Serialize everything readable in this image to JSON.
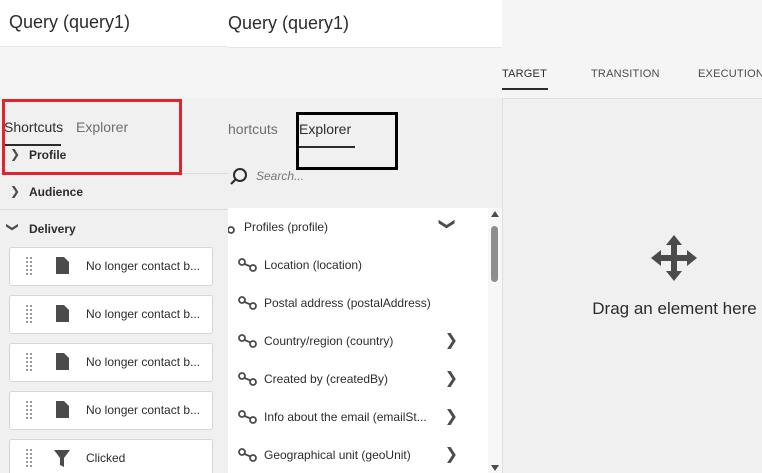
{
  "left_panel": {
    "title": "Query (query1)",
    "tabs": {
      "shortcuts": "Shortcuts",
      "explorer": "Explorer"
    },
    "sections": {
      "profile": "Profile",
      "audience": "Audience",
      "delivery": "Delivery"
    },
    "items": [
      {
        "label": "No longer contact b...",
        "icon": "document-icon"
      },
      {
        "label": "No longer contact b...",
        "icon": "document-icon"
      },
      {
        "label": "No longer contact b...",
        "icon": "document-icon"
      },
      {
        "label": "No longer contact b...",
        "icon": "document-icon"
      },
      {
        "label": "Clicked",
        "icon": "filter-icon"
      }
    ]
  },
  "middle_panel": {
    "title": "Query (query1)",
    "tabs": {
      "shortcuts": "hortcuts",
      "explorer": "Explorer"
    },
    "search": {
      "placeholder": "Search..."
    },
    "tree": [
      {
        "label": "Profiles (profile)",
        "indicator": "chevron-down"
      },
      {
        "label": "Location (location)",
        "indicator": "none"
      },
      {
        "label": "Postal address (postalAddress)",
        "indicator": "none"
      },
      {
        "label": "Country/region (country)",
        "indicator": "chevron-right"
      },
      {
        "label": "Created by (createdBy)",
        "indicator": "chevron-right"
      },
      {
        "label": "Info about the email (emailSt...",
        "indicator": "chevron-right"
      },
      {
        "label": "Geographical unit (geoUnit)",
        "indicator": "chevron-right"
      }
    ]
  },
  "right_panel": {
    "tabs": [
      "TARGET",
      "TRANSITION",
      "EXECUTION"
    ],
    "active_tab": "TARGET",
    "drop_hint": "Drag an element here"
  },
  "colors": {
    "highlight_red": "#e0242e",
    "highlight_black": "#000000",
    "panel_bg": "#f0f0f0"
  }
}
